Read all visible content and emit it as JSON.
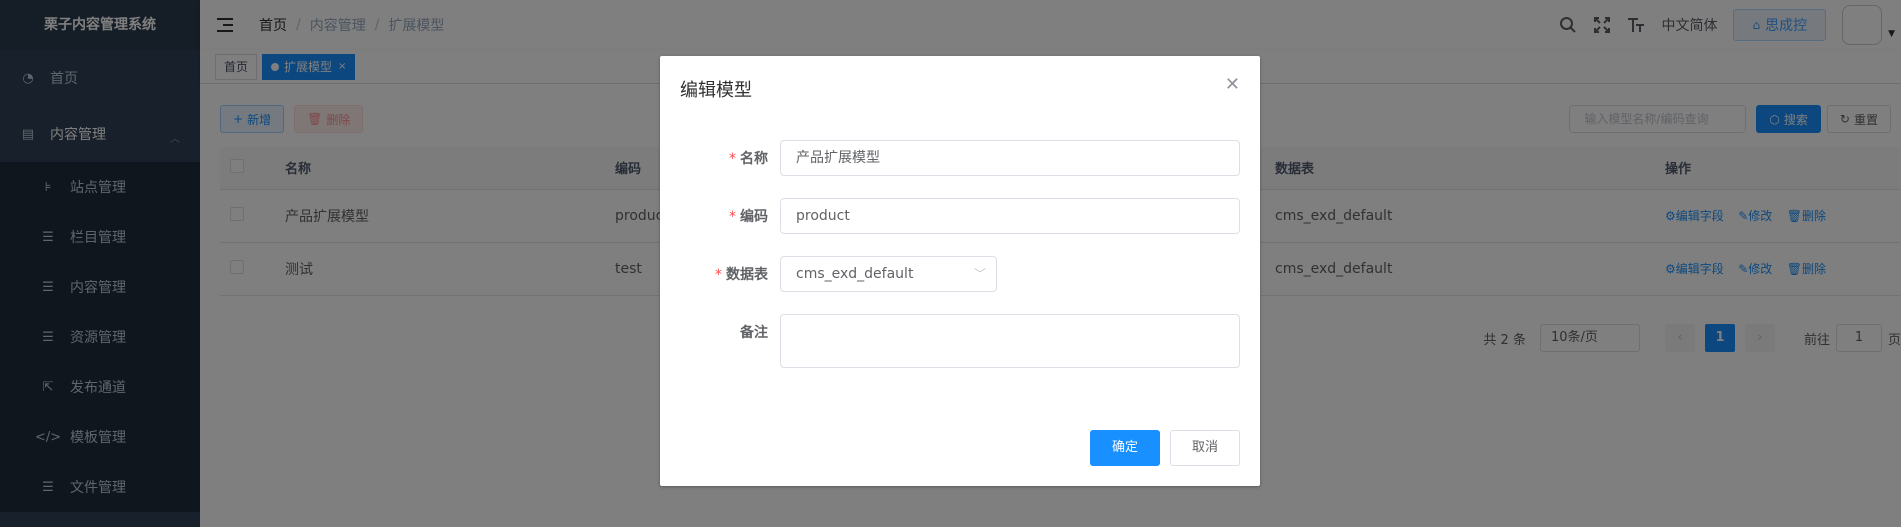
{
  "app": {
    "title": "栗子内容管理系统"
  },
  "sidebar": {
    "items": [
      {
        "label": "首页",
        "icon": "dashboard-icon"
      },
      {
        "label": "内容管理",
        "icon": "document-icon"
      }
    ],
    "submenu": [
      {
        "label": "站点管理",
        "icon": "tree-icon"
      },
      {
        "label": "栏目管理",
        "icon": "list-tree-icon"
      },
      {
        "label": "内容管理",
        "icon": "list-icon"
      },
      {
        "label": "资源管理",
        "icon": "list-icon"
      },
      {
        "label": "发布通道",
        "icon": "publish-icon"
      },
      {
        "label": "模板管理",
        "icon": "code-icon"
      },
      {
        "label": "文件管理",
        "icon": "list-tree-icon"
      }
    ]
  },
  "header": {
    "breadcrumb": [
      "首页",
      "内容管理",
      "扩展模型"
    ],
    "language": "中文简体",
    "site_button": "思成控"
  },
  "tags": {
    "home": "首页",
    "active": "扩展模型"
  },
  "toolbar": {
    "add": "新增",
    "delete": "删除"
  },
  "search": {
    "placeholder": "输入模型名称/编码查询",
    "search": "搜索",
    "reset": "重置"
  },
  "table": {
    "columns": [
      "名称",
      "编码",
      "数据表",
      "操作"
    ],
    "rows": [
      {
        "name": "产品扩展模型",
        "code": "product",
        "table": "cms_exd_default"
      },
      {
        "name": "测试",
        "code": "test",
        "table": "cms_exd_default"
      }
    ],
    "actions": [
      "编辑字段",
      "修改",
      "删除"
    ]
  },
  "pager": {
    "total": "共 2 条",
    "page_size": "10条/页",
    "current": "1",
    "goto_label": "前往",
    "goto_value": "1",
    "page_suffix": "页"
  },
  "dialog": {
    "title": "编辑模型",
    "fields": {
      "name_label": "名称",
      "name_value": "产品扩展模型",
      "code_label": "编码",
      "code_value": "product",
      "table_label": "数据表",
      "table_value": "cms_exd_default",
      "remark_label": "备注",
      "remark_value": ""
    },
    "ok": "确定",
    "cancel": "取消"
  },
  "colors": {
    "primary": "#1890ff",
    "sidebar": "#304156",
    "danger": "#ff4949"
  }
}
